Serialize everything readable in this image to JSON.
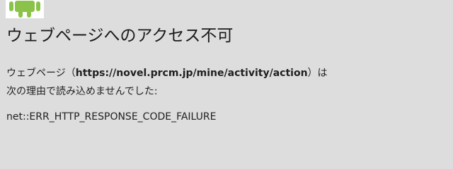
{
  "icon": {
    "name": "android-error-icon",
    "color": "#8bc34a"
  },
  "error": {
    "title": "ウェブページへのアクセス不可",
    "description_prefix": "ウェブページ（",
    "url": "https://novel.prcm.jp/mine/activity/action",
    "description_suffix": "）は次の理由で読み込めませんでした:",
    "code": "net::ERR_HTTP_RESPONSE_CODE_FAILURE"
  },
  "colors": {
    "background": "#dddddd",
    "text": "#1a1a1a"
  }
}
